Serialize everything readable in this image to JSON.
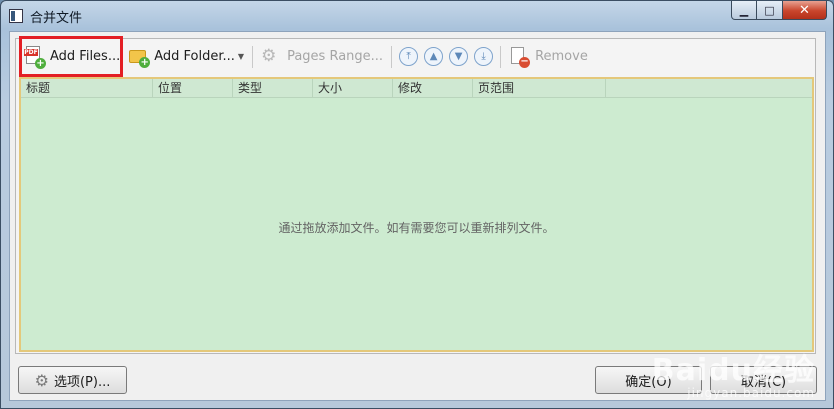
{
  "window": {
    "title": "合并文件",
    "buttons": {
      "minimize": "▁",
      "maximize": "□",
      "close": "✕"
    }
  },
  "toolbar": {
    "add_files": "Add Files...",
    "add_folder": "Add Folder...",
    "pages_range": "Pages Range...",
    "remove": "Remove",
    "nav_icons": [
      "move-top-icon",
      "move-up-icon",
      "move-down-icon",
      "move-bottom-icon"
    ],
    "nav_glyphs": [
      "⤒",
      "▲",
      "▼",
      "⤓"
    ],
    "pdf_tag": "PDF"
  },
  "grid": {
    "columns": [
      "标题",
      "位置",
      "类型",
      "大小",
      "修改",
      "页范围"
    ],
    "empty_message": "通过拖放添加文件。如有需要您可以重新排列文件。"
  },
  "footer": {
    "options": "选项(P)...",
    "ok": "确定(O)",
    "cancel": "取消(C)"
  },
  "watermark": {
    "logo": "Baidu经验",
    "url": "jingyan.baidu.com"
  },
  "colors": {
    "highlight": "#e31e24",
    "grid_bg": "#cdebd0",
    "grid_border": "#e4c87a"
  }
}
